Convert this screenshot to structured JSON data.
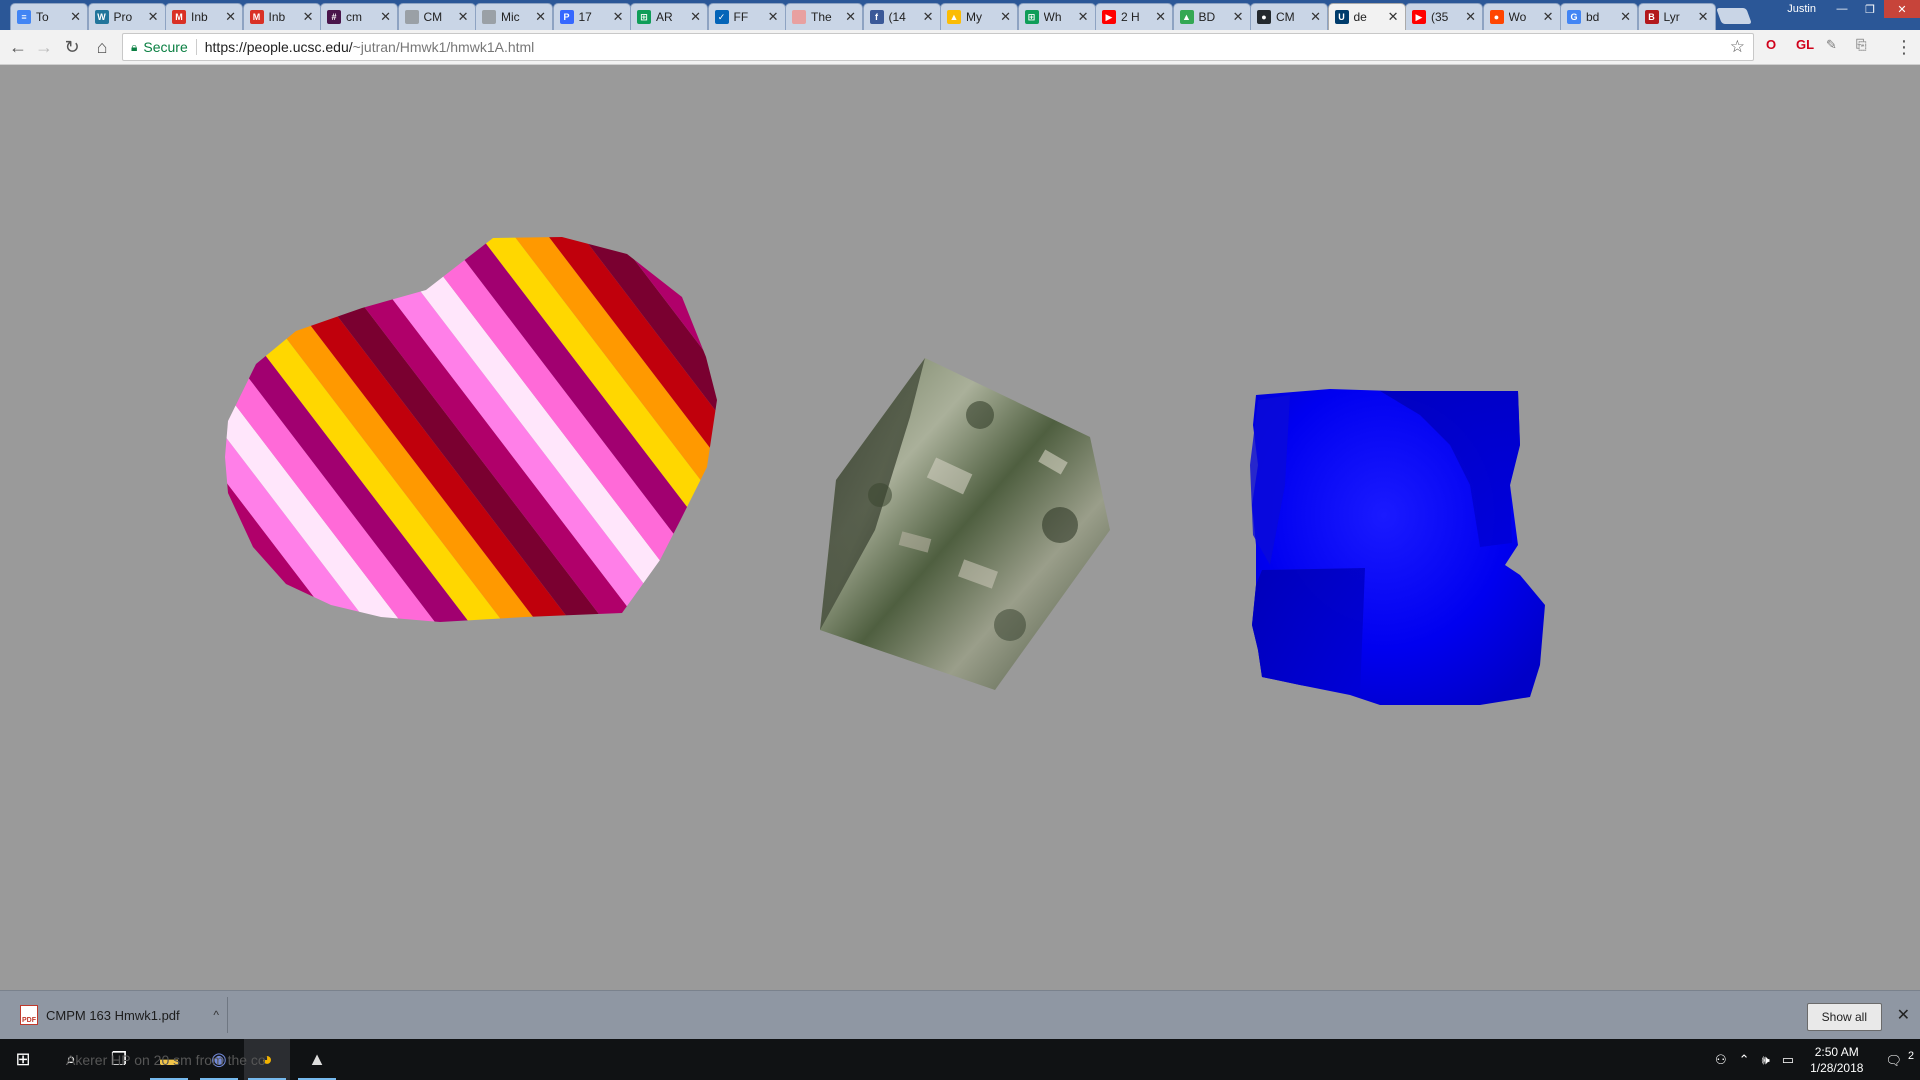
{
  "browser": {
    "tabs": [
      {
        "title": "To",
        "icon": "google-docs-icon",
        "color": "#4285f4",
        "glyph": "≡"
      },
      {
        "title": "Pro",
        "icon": "wordpress-icon",
        "color": "#21759b",
        "glyph": "W"
      },
      {
        "title": "Inb",
        "icon": "gmail-icon",
        "color": "#d93025",
        "glyph": "M"
      },
      {
        "title": "Inb",
        "icon": "gmail-icon",
        "color": "#d93025",
        "glyph": "M"
      },
      {
        "title": "cm",
        "icon": "slack-icon",
        "color": "#4a154b",
        "glyph": "#"
      },
      {
        "title": "CM",
        "icon": "document-icon",
        "color": "#9aa0a6",
        "glyph": ""
      },
      {
        "title": "Mic",
        "icon": "document-icon",
        "color": "#9aa0a6",
        "glyph": ""
      },
      {
        "title": "17",
        "icon": "pandora-icon",
        "color": "#3668ff",
        "glyph": "P"
      },
      {
        "title": "AR",
        "icon": "google-sheets-icon",
        "color": "#0f9d58",
        "glyph": "⊞"
      },
      {
        "title": "FF",
        "icon": "mail-icon",
        "color": "#0364b8",
        "glyph": "✓"
      },
      {
        "title": "The",
        "icon": "anime-icon",
        "color": "#e8a0a0",
        "glyph": ""
      },
      {
        "title": "(14",
        "icon": "facebook-icon",
        "color": "#3b5998",
        "glyph": "f"
      },
      {
        "title": "My",
        "icon": "google-drive-icon",
        "color": "#fbbc04",
        "glyph": "▲"
      },
      {
        "title": "Wh",
        "icon": "google-sheets-icon",
        "color": "#0f9d58",
        "glyph": "⊞"
      },
      {
        "title": "2 H",
        "icon": "youtube-icon",
        "color": "#ff0000",
        "glyph": "▶"
      },
      {
        "title": "BD",
        "icon": "google-drive-icon",
        "color": "#34a853",
        "glyph": "▲"
      },
      {
        "title": "CM",
        "icon": "github-icon",
        "color": "#24292e",
        "glyph": "●"
      },
      {
        "title": "de",
        "icon": "ucsc-icon",
        "color": "#003c6c",
        "glyph": "U"
      },
      {
        "title": "(35",
        "icon": "youtube-icon",
        "color": "#ff0000",
        "glyph": "▶"
      },
      {
        "title": "Wo",
        "icon": "reddit-icon",
        "color": "#ff4500",
        "glyph": "●"
      },
      {
        "title": "bd",
        "icon": "google-icon",
        "color": "#4285f4",
        "glyph": "G"
      },
      {
        "title": "Lyr",
        "icon": "genius-icon",
        "color": "#b3181c",
        "glyph": "B"
      }
    ],
    "active_tab": 17,
    "profile_name": "Justin",
    "secure_label": "Secure",
    "url_host": "https://people.ucsc.edu/",
    "url_path": "~jutran/Hmwk1/hmwk1A.html",
    "extensions": [
      {
        "name": "opera-extension-icon",
        "glyph": "O",
        "color": "#d0021b"
      },
      {
        "name": "gl-extension-icon",
        "glyph": "GL",
        "color": "#d0021b"
      },
      {
        "name": "pen-extension-icon",
        "glyph": "✎",
        "color": "#777"
      },
      {
        "name": "acrobat-extension-icon",
        "glyph": "⎘",
        "color": "#999"
      }
    ]
  },
  "scene": {
    "background": "#9a9a9a",
    "objects": [
      "striped-sphere",
      "textured-cube",
      "blue-blob"
    ],
    "stripe_colors": [
      "#ffd700",
      "#ff9900",
      "#c0000c",
      "#7a0030",
      "#b0006a",
      "#ff7fe8",
      "#ffe6fb",
      "#ff6ad8",
      "#a10070"
    ],
    "blob_colors": [
      "#0000ff",
      "#1010e0",
      "#0a0ad0",
      "#2020f0"
    ],
    "cube_colors": [
      "#3a4232",
      "#5e6b52",
      "#8a8f7a",
      "#4a5a3e",
      "#2d332a"
    ]
  },
  "downloads": {
    "file_name": "CMPM 163 Hmwk1.pdf",
    "show_all_label": "Show all"
  },
  "taskbar": {
    "ghost_text": "Akerer HP on 20 sm from the co",
    "time": "2:50 AM",
    "date": "1/28/2018",
    "notification_count": "2"
  }
}
